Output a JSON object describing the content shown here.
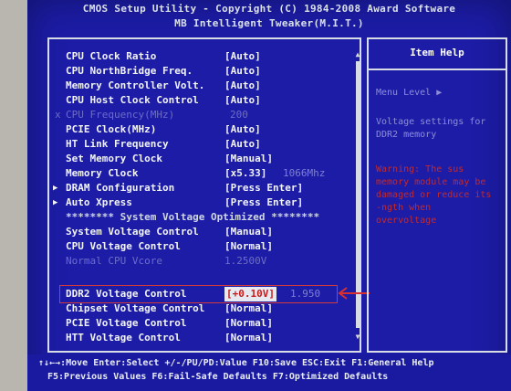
{
  "title": {
    "line1": "CMOS Setup Utility - Copyright (C) 1984-2008 Award Software",
    "line2": "MB Intelligent Tweaker(M.I.T.)"
  },
  "settings": [
    {
      "label": "CPU Clock Ratio",
      "value": "[Auto]"
    },
    {
      "label": "CPU NorthBridge Freq.",
      "value": "[Auto]"
    },
    {
      "label": "Memory Controller Volt.",
      "value": "[Auto]"
    },
    {
      "label": "CPU Host Clock Control",
      "value": "[Auto]"
    },
    {
      "label": "CPU Frequency(MHz)",
      "value": "200",
      "marker": "x"
    },
    {
      "label": "PCIE Clock(MHz)",
      "value": "[Auto]"
    },
    {
      "label": "HT Link Frequency",
      "value": "[Auto]"
    },
    {
      "label": "Set Memory Clock",
      "value": "[Manual]"
    },
    {
      "label": "Memory Clock",
      "value": "[x5.33]",
      "extra": "1066Mhz"
    },
    {
      "label": "DRAM Configuration",
      "value": "[Press Enter]",
      "marker": "▶"
    },
    {
      "label": "Auto Xpress",
      "value": "[Press Enter]",
      "marker": "▶"
    },
    {
      "separator": "******** System Voltage Optimized ********"
    },
    {
      "label": "System Voltage Control",
      "value": "[Manual]"
    },
    {
      "label": "CPU Voltage Control",
      "value": "[Normal]"
    },
    {
      "label": "Normal CPU Vcore",
      "value": "1.2500V"
    },
    {
      "label": "DDR2 Voltage Control",
      "value": "[+0.10V]",
      "extra": "1.950"
    },
    {
      "label": "Chipset Voltage Control",
      "value": "[Normal]"
    },
    {
      "label": "PCIE Voltage Control",
      "value": "[Normal]"
    },
    {
      "label": "HTT Voltage Control",
      "value": "[Normal]"
    }
  ],
  "help": {
    "title": "Item Help",
    "menu_level": "Menu Level  ▶",
    "desc1": "Voltage settings for",
    "desc2": "DDR2 memory",
    "warn1": "Warning: The sus",
    "warn2": "memory module may be",
    "warn3": "damaged or reduce its",
    "warn4": "-ngth when",
    "warn5": "overvoltage"
  },
  "scroll": {
    "up": "▲",
    "down": "▼"
  },
  "footer": {
    "line1": "↑↓←→:Move  Enter:Select  +/-/PU/PD:Value  F10:Save  ESC:Exit  F1:General Help",
    "line2": "F5:Previous Values  F6:Fail-Safe Defaults  F7:Optimized Defaults"
  },
  "colors": {
    "background": "#1c1ca6",
    "text": "#f2f4f8",
    "dimmed": "#6d6dc8",
    "warning": "#c42a2a",
    "highlight": "#c41c1c"
  }
}
